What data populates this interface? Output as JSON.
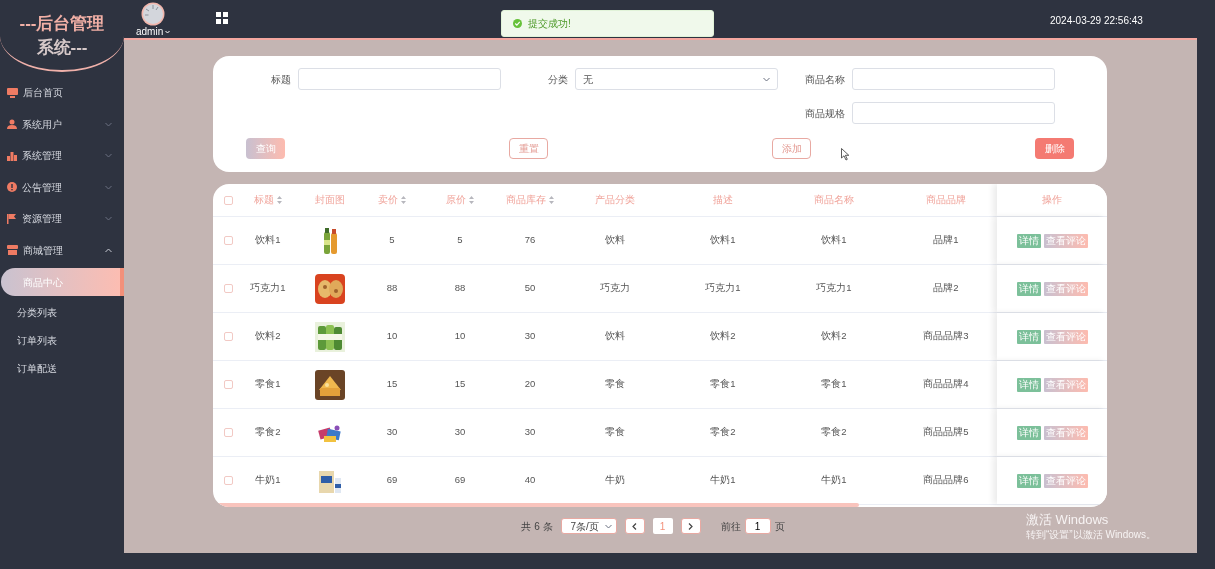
{
  "sidebar": {
    "logo": [
      "---后台管理",
      "系统---"
    ],
    "items": [
      {
        "label": "后台首页",
        "has_children": false,
        "expanded": false
      },
      {
        "label": "系统用户",
        "has_children": true,
        "expanded": false
      },
      {
        "label": "系统管理",
        "has_children": true,
        "expanded": false
      },
      {
        "label": "公告管理",
        "has_children": true,
        "expanded": false
      },
      {
        "label": "资源管理",
        "has_children": true,
        "expanded": false
      },
      {
        "label": "商城管理",
        "has_children": true,
        "expanded": true,
        "children": [
          {
            "label": "商品中心",
            "selected": true
          },
          {
            "label": "分类列表",
            "selected": false
          },
          {
            "label": "订单列表",
            "selected": false
          },
          {
            "label": "订单配送",
            "selected": false
          }
        ]
      }
    ]
  },
  "header": {
    "user": "admin",
    "datetime": "2024-03-29 22:56:43"
  },
  "toast": {
    "message": "提交成功!"
  },
  "search": {
    "fields": [
      {
        "label": "标题",
        "kind": "input"
      },
      {
        "label": "分类",
        "kind": "select",
        "value": "无"
      },
      {
        "label": "商品名称",
        "kind": "input"
      },
      {
        "label": "商品规格",
        "kind": "input"
      }
    ],
    "buttons": [
      {
        "label": "查询",
        "kind": "gradient"
      },
      {
        "label": "重置",
        "kind": "outline"
      },
      {
        "label": "添加",
        "kind": "outline"
      },
      {
        "label": "删除",
        "kind": "danger"
      }
    ]
  },
  "table": {
    "select_all": {
      "checked": false
    },
    "columns": [
      {
        "label": "标题",
        "sortable": true
      },
      {
        "label": "封面图",
        "sortable": false
      },
      {
        "label": "卖价",
        "sortable": true
      },
      {
        "label": "原价",
        "sortable": true
      },
      {
        "label": "商品库存",
        "sortable": true
      },
      {
        "label": "产品分类",
        "sortable": false
      },
      {
        "label": "描述",
        "sortable": false
      },
      {
        "label": "商品名称",
        "sortable": false
      },
      {
        "label": "商品品牌",
        "sortable": false
      },
      {
        "label": "操作",
        "sortable": false
      }
    ],
    "rows": [
      {
        "checked": false,
        "cells": [
          "饮料1",
          {
            "kind": "picture"
          },
          "5",
          "5",
          "76",
          "饮料",
          "饮料1",
          "饮料1",
          "品牌1"
        ],
        "actions": [
          "详情",
          "查看评论"
        ]
      },
      {
        "checked": false,
        "cells": [
          "巧克力1",
          {
            "kind": "picture"
          },
          "88",
          "88",
          "50",
          "巧克力",
          "巧克力1",
          "巧克力1",
          "品牌2"
        ],
        "actions": [
          "详情",
          "查看评论"
        ]
      },
      {
        "checked": false,
        "cells": [
          "饮料2",
          {
            "kind": "picture"
          },
          "10",
          "10",
          "30",
          "饮料",
          "饮料2",
          "饮料2",
          "商品品牌3"
        ],
        "actions": [
          "详情",
          "查看评论"
        ]
      },
      {
        "checked": false,
        "cells": [
          "零食1",
          {
            "kind": "picture"
          },
          "15",
          "15",
          "20",
          "零食",
          "零食1",
          "零食1",
          "商品品牌4"
        ],
        "actions": [
          "详情",
          "查看评论"
        ]
      },
      {
        "checked": false,
        "cells": [
          "零食2",
          {
            "kind": "picture"
          },
          "30",
          "30",
          "30",
          "零食",
          "零食2",
          "零食2",
          "商品品牌5"
        ],
        "actions": [
          "详情",
          "查看评论"
        ]
      },
      {
        "checked": false,
        "cells": [
          "牛奶1",
          {
            "kind": "picture"
          },
          "69",
          "69",
          "40",
          "牛奶",
          "牛奶1",
          "牛奶1",
          "商品品牌6"
        ],
        "actions": [
          "详情",
          "查看评论"
        ]
      }
    ]
  },
  "pagination": {
    "total": "共 6 条",
    "page_size": "7条/页",
    "pages": [
      {
        "label": "1",
        "selected": true
      }
    ],
    "goto_label": "前往",
    "goto_value": "1",
    "goto_suffix": "页"
  },
  "os_notice": {
    "title": "激活 Windows",
    "text": "转到“设置”以激活 Windows。"
  }
}
